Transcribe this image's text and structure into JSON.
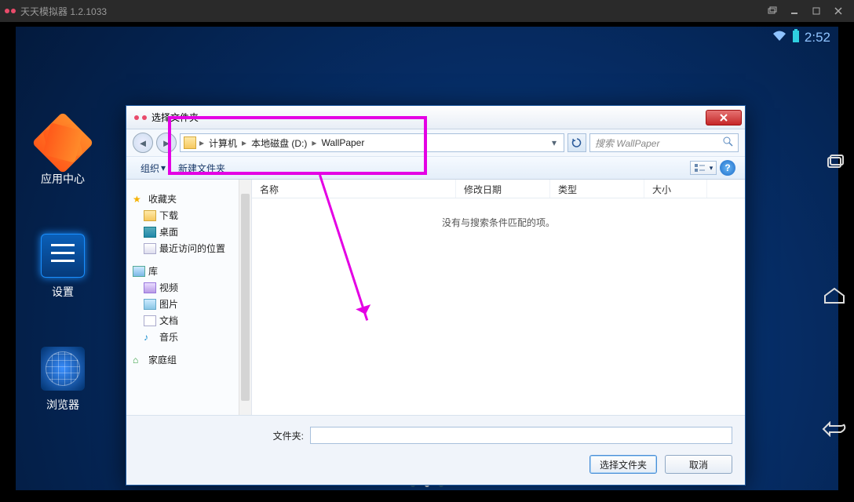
{
  "app": {
    "title": "天天模拟器 1.2.1033"
  },
  "statusbar": {
    "time": "2:52"
  },
  "launcher": {
    "appcenter": "应用中心",
    "settings": "设置",
    "browser": "浏览器"
  },
  "dialog": {
    "title": "选择文件夹",
    "breadcrumb": {
      "seg1": "计算机",
      "seg2": "本地磁盘 (D:)",
      "seg3": "WallPaper"
    },
    "search_placeholder": "搜索 WallPaper",
    "toolbar": {
      "organize": "组织",
      "newfolder": "新建文件夹"
    },
    "tree": {
      "favorites": "收藏夹",
      "downloads": "下载",
      "desktop": "桌面",
      "recent": "最近访问的位置",
      "libraries": "库",
      "videos": "视频",
      "pictures": "图片",
      "documents": "文档",
      "music": "音乐",
      "homegroup": "家庭组"
    },
    "columns": {
      "name": "名称",
      "date": "修改日期",
      "type": "类型",
      "size": "大小"
    },
    "empty": "没有与搜索条件匹配的项。",
    "footer": {
      "label": "文件夹:",
      "select": "选择文件夹",
      "cancel": "取消"
    }
  }
}
